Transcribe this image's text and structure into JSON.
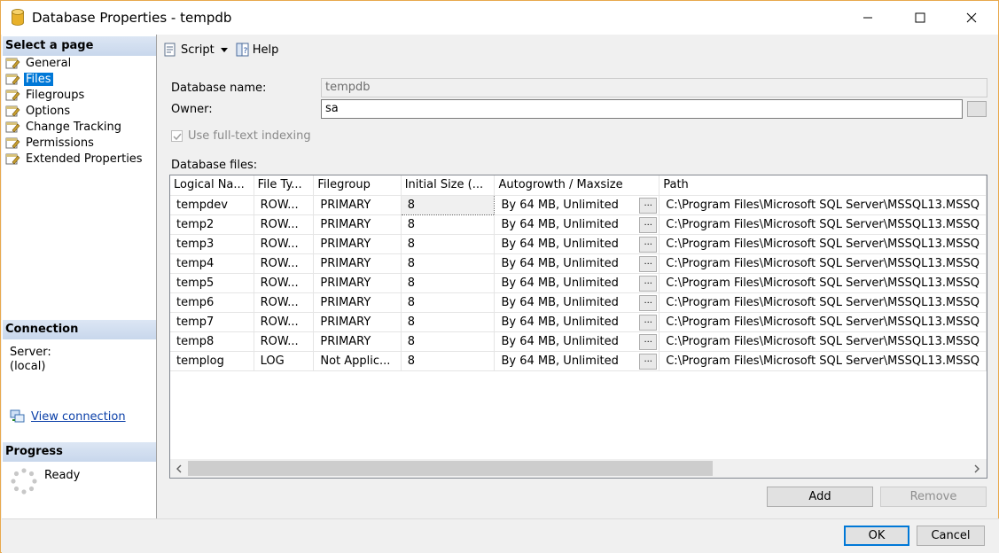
{
  "window": {
    "title": "Database Properties - tempdb"
  },
  "sidebar": {
    "select_page_header": "Select a page",
    "pages": [
      {
        "label": "General",
        "selected": false
      },
      {
        "label": "Files",
        "selected": true
      },
      {
        "label": "Filegroups",
        "selected": false
      },
      {
        "label": "Options",
        "selected": false
      },
      {
        "label": "Change Tracking",
        "selected": false
      },
      {
        "label": "Permissions",
        "selected": false
      },
      {
        "label": "Extended Properties",
        "selected": false
      }
    ],
    "connection_header": "Connection",
    "server_label": "Server:",
    "server_value": "(local)",
    "view_connection": "View connection",
    "progress_header": "Progress",
    "progress_status": "Ready"
  },
  "toolbar": {
    "script_label": "Script",
    "help_label": "Help"
  },
  "form": {
    "db_name_label": "Database name:",
    "db_name_value": "tempdb",
    "owner_label": "Owner:",
    "owner_value": "sa",
    "fulltext_label": "Use full-text indexing",
    "db_files_label": "Database files:"
  },
  "grid": {
    "columns": [
      "Logical Na...",
      "File Ty...",
      "Filegroup",
      "Initial Size (...",
      "Autogrowth / Maxsize",
      "Path"
    ],
    "rows": [
      [
        "tempdev",
        "ROW...",
        "PRIMARY",
        "8",
        "By 64 MB, Unlimited",
        "C:\\Program Files\\Microsoft SQL Server\\MSSQL13.MSSQ"
      ],
      [
        "temp2",
        "ROW...",
        "PRIMARY",
        "8",
        "By 64 MB, Unlimited",
        "C:\\Program Files\\Microsoft SQL Server\\MSSQL13.MSSQ"
      ],
      [
        "temp3",
        "ROW...",
        "PRIMARY",
        "8",
        "By 64 MB, Unlimited",
        "C:\\Program Files\\Microsoft SQL Server\\MSSQL13.MSSQ"
      ],
      [
        "temp4",
        "ROW...",
        "PRIMARY",
        "8",
        "By 64 MB, Unlimited",
        "C:\\Program Files\\Microsoft SQL Server\\MSSQL13.MSSQ"
      ],
      [
        "temp5",
        "ROW...",
        "PRIMARY",
        "8",
        "By 64 MB, Unlimited",
        "C:\\Program Files\\Microsoft SQL Server\\MSSQL13.MSSQ"
      ],
      [
        "temp6",
        "ROW...",
        "PRIMARY",
        "8",
        "By 64 MB, Unlimited",
        "C:\\Program Files\\Microsoft SQL Server\\MSSQL13.MSSQ"
      ],
      [
        "temp7",
        "ROW...",
        "PRIMARY",
        "8",
        "By 64 MB, Unlimited",
        "C:\\Program Files\\Microsoft SQL Server\\MSSQL13.MSSQ"
      ],
      [
        "temp8",
        "ROW...",
        "PRIMARY",
        "8",
        "By 64 MB, Unlimited",
        "C:\\Program Files\\Microsoft SQL Server\\MSSQL13.MSSQ"
      ],
      [
        "templog",
        "LOG",
        "Not Applic...",
        "8",
        "By 64 MB, Unlimited",
        "C:\\Program Files\\Microsoft SQL Server\\MSSQL13.MSSQ"
      ]
    ],
    "cell_button_label": "..."
  },
  "buttons": {
    "add": "Add",
    "remove": "Remove",
    "ok": "OK",
    "cancel": "Cancel"
  },
  "colors": {
    "accent": "#0078d7",
    "window_border": "#e8a84d",
    "link": "#0a3fa8"
  }
}
